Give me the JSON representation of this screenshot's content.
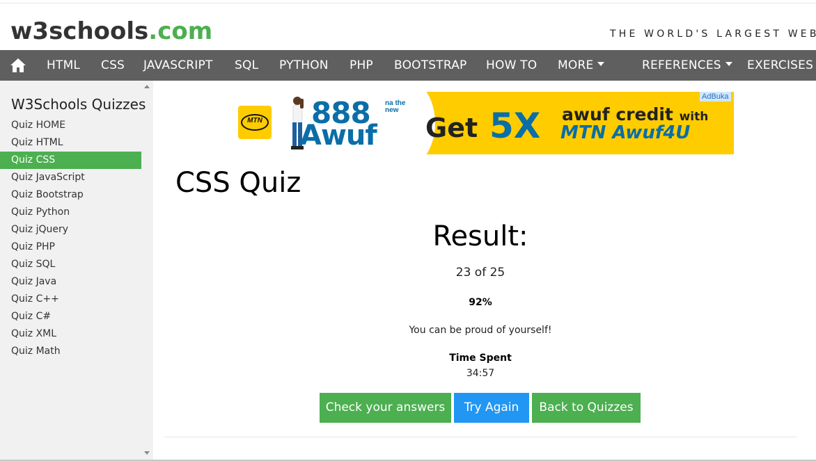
{
  "header": {
    "logo_main": "w3schools",
    "logo_suffix": ".com",
    "tagline": "THE WORLD'S LARGEST WEB D"
  },
  "navbar": {
    "home_icon": "home-icon",
    "items": [
      {
        "label": "HTML"
      },
      {
        "label": "CSS"
      },
      {
        "label": "JAVASCRIPT"
      },
      {
        "label": "SQL"
      },
      {
        "label": "PYTHON"
      },
      {
        "label": "PHP"
      },
      {
        "label": "BOOTSTRAP"
      },
      {
        "label": "HOW TO"
      },
      {
        "label": "MORE"
      },
      {
        "label": "REFERENCES"
      },
      {
        "label": "EXERCISES"
      }
    ]
  },
  "sidebar": {
    "title": "W3Schools Quizzes",
    "items": [
      {
        "label": "Quiz HOME"
      },
      {
        "label": "Quiz HTML"
      },
      {
        "label": "Quiz CSS"
      },
      {
        "label": "Quiz JavaScript"
      },
      {
        "label": "Quiz Bootstrap"
      },
      {
        "label": "Quiz Python"
      },
      {
        "label": "Quiz jQuery"
      },
      {
        "label": "Quiz PHP"
      },
      {
        "label": "Quiz SQL"
      },
      {
        "label": "Quiz Java"
      },
      {
        "label": "Quiz C++"
      },
      {
        "label": "Quiz C#"
      },
      {
        "label": "Quiz XML"
      },
      {
        "label": "Quiz Math"
      }
    ],
    "active_item": "Quiz CSS"
  },
  "ad": {
    "badge": "AdBuka",
    "mtn": "MTN",
    "number": "888",
    "na_the": "na the",
    "new": "new",
    "awuf": "Awuf",
    "get": "Get",
    "multiplier": "5X",
    "credit": "awuf credit",
    "with": "with",
    "brand_line": "MTN Awuf4U",
    "colors": {
      "background": "#ffcc00",
      "brand_blue": "#0a6ea8"
    }
  },
  "main": {
    "title": "CSS Quiz",
    "result_heading": "Result:",
    "score": "23 of 25",
    "percent": "92%",
    "message": "You can be proud of yourself!",
    "time_label": "Time Spent",
    "time_value": "34:57"
  },
  "buttons": {
    "check": "Check your answers",
    "try_again": "Try Again",
    "back": "Back to Quizzes"
  },
  "colors": {
    "accent_green": "#4CAF50",
    "accent_blue": "#2196F3",
    "nav_bg": "#5f5f5f",
    "sidebar_bg": "#f1f1f1"
  }
}
